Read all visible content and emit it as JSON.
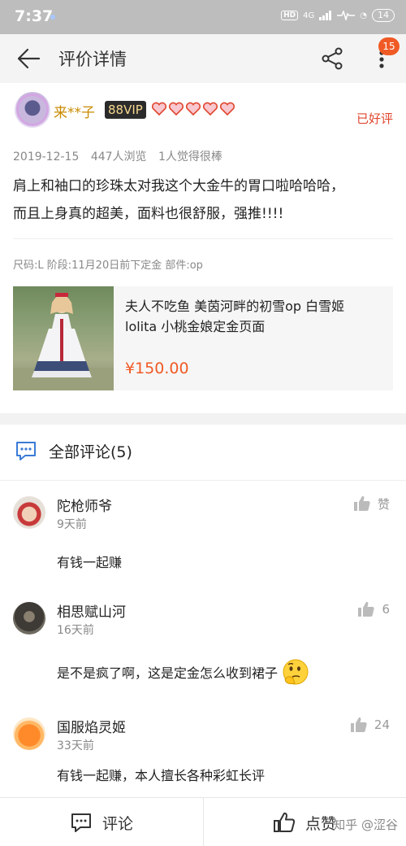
{
  "status_bar": {
    "time": "7:37",
    "hd": "HD",
    "signal": "4G",
    "battery": "14"
  },
  "header": {
    "title": "评价详情",
    "cart_badge": "15"
  },
  "review": {
    "username": "来**子",
    "vip": "88VIP",
    "good_tag": "已好评",
    "date": "2019-12-15",
    "views": "447人浏览",
    "helpful": "1人觉得很棒",
    "text_line1": "肩上和袖口的珍珠太对我这个大金牛的胃口啦哈哈哈，",
    "text_line2": "而且上身真的超美，面料也很舒服，强推!!!!",
    "sku": "尺码:L 阶段:11月20日前下定金 部件:op"
  },
  "product": {
    "title_line1": "夫人不吃鱼 美茵河畔的初雪op 白雪姬",
    "title_line2": "lolita 小桃金娘定金页面",
    "price": "¥150.00"
  },
  "comments_section": {
    "title": "全部评论(5)"
  },
  "comments": [
    {
      "name": "陀枪师爷",
      "time": "9天前",
      "text": "有钱一起赚",
      "likes": "赞"
    },
    {
      "name": "相思赋山河",
      "time": "16天前",
      "text": "是不是疯了啊，这是定金怎么收到裙子",
      "likes": "6"
    },
    {
      "name": "国服焰灵姬",
      "time": "33天前",
      "text": "有钱一起赚，本人擅长各种彩虹长评",
      "likes": "24"
    }
  ],
  "bottom_bar": {
    "comment_label": "评论",
    "like_label": "点赞"
  },
  "watermark": "知乎 @涩谷",
  "colors": {
    "accent": "#f05a25",
    "vip_gold": "#c98a00",
    "good_red": "#e0462e"
  }
}
